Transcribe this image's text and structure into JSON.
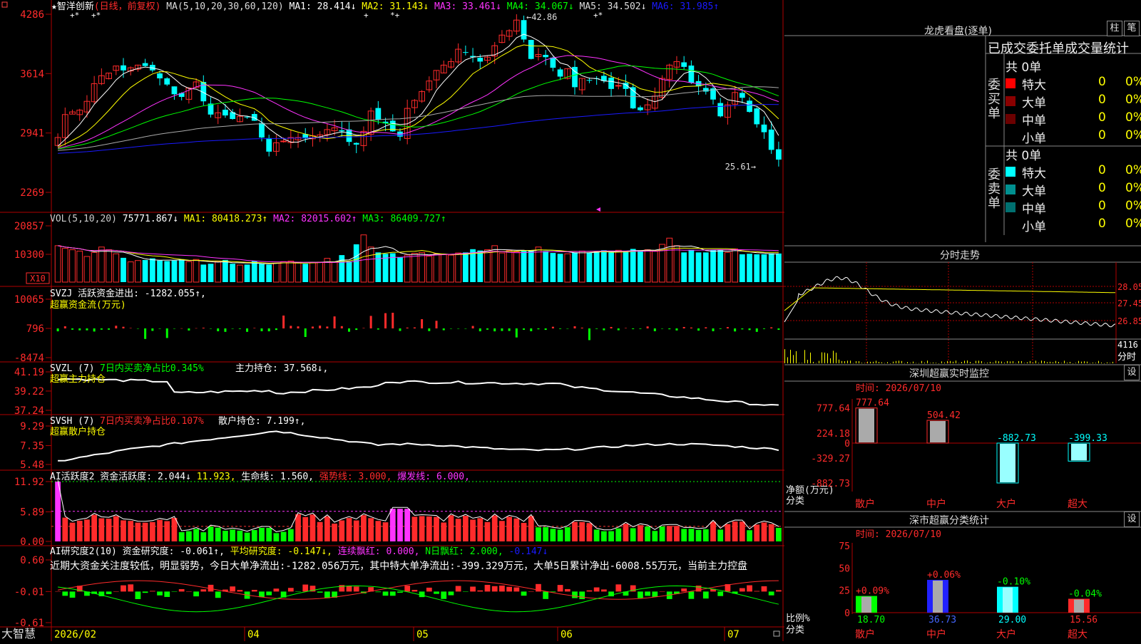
{
  "colors": {
    "up": "#ff2b2b",
    "down": "#00ffff",
    "bg": "#000000",
    "axis": "#b00000",
    "ma1": "#ffffff",
    "ma2": "#ffff00",
    "ma3": "#ff33ff",
    "ma4": "#00ff00",
    "ma5": "#aaaaaa",
    "ma6": "#1a1aff",
    "green": "#00ff00"
  },
  "main_panel": {
    "stock_name": "智洋创新",
    "mode": "(日线，前复权)",
    "ma_params": "MA(5,10,20,30,60,120)",
    "ma1": "MA1: 28.414↓",
    "ma2": "MA2: 31.143↓",
    "ma3": "MA3: 33.461↓",
    "ma4": "MA4: 34.067↓",
    "ma5": "MA5: 34.502↓",
    "ma6": "MA6: 31.985↑",
    "high_label": "42.86",
    "low_label": "25.61",
    "y_ticks": [
      "4286",
      "3614",
      "2941",
      "2269"
    ],
    "markers": [
      "+*",
      "+*",
      "+",
      "*+",
      "+*"
    ]
  },
  "vol_panel": {
    "title": "VOL(5,10,20)",
    "value": "75771.867↓",
    "ma1": "MA1: 80418.273↑",
    "ma2": "MA2: 82015.602↑",
    "ma3": "MA3: 86409.727↑",
    "y_ticks": [
      "20857",
      "10300"
    ],
    "unit": "X10"
  },
  "svzj_panel": {
    "title": "SVZJ  活跃资金进出: -1282.055↑,",
    "subtitle": "超赢资金流(万元)",
    "y_ticks": [
      "10065",
      "796",
      "-8474"
    ]
  },
  "svzl_panel": {
    "title": "SVZL (7)",
    "stat": "7日内买卖净占比0.345%",
    "hold": "主力持仓: 37.568↓,",
    "subtitle": "超赢主力持仓",
    "y_ticks": [
      "41.19",
      "39.22",
      "37.24"
    ]
  },
  "svsh_panel": {
    "title": "SVSH (7)",
    "stat": "7日内买卖净占比0.107%",
    "hold": "散户持仓: 7.199↑,",
    "subtitle": "超赢散户持仓",
    "y_ticks": [
      "9.29",
      "7.35",
      "5.48"
    ]
  },
  "ai1_panel": {
    "title": "AI活跃度2",
    "a": "资金活跃度: 2.044↓",
    "b": "11.923,",
    "c": "生命线: 1.560,",
    "d": "强势线: 3.000,",
    "e": "爆发线: 6.000,",
    "y_ticks": [
      "11.92",
      "5.89",
      "0.00"
    ]
  },
  "ai2_panel": {
    "title": "AI研究度2(10)",
    "a": "资金研究度: -0.061↑,",
    "b": "平均研究度: -0.147↓,",
    "c": "连续飘红: 0.000,",
    "d": "N日飘红: 2.000,",
    "e": "-0.147↓",
    "comment": "近期大资金关注度较低，明显弱势，今日大单净流出:-1282.056万元，其中特大单净流出:-399.329万元，大单5日累计净出-6008.55万元，当前主力控盘",
    "y_ticks": [
      "0.60",
      "-0.01",
      "-0.61"
    ]
  },
  "x_axis": {
    "labels": [
      "2026/02",
      "04",
      "05",
      "06",
      "07"
    ],
    "brand": "大智慧"
  },
  "lhb": {
    "title": "龙虎看盘(逐单)",
    "btn1": "柱",
    "btn2": "笔",
    "header": "已成交委托单成交量统计",
    "buy_label": "委买单",
    "sell_label": "委卖单",
    "total": "共 0单",
    "rows": [
      {
        "name": "特大",
        "v": "0",
        "p": "0%"
      },
      {
        "name": "大单",
        "v": "0",
        "p": "0%"
      },
      {
        "name": "中单",
        "v": "0",
        "p": "0%"
      },
      {
        "name": "小单",
        "v": "0",
        "p": "0%"
      }
    ],
    "buy_colors": [
      "#ff0000",
      "#8b0000",
      "#6b0000"
    ],
    "sell_colors": [
      "#00ffff",
      "#009090",
      "#007070"
    ]
  },
  "fenshi": {
    "title": "分时走势",
    "prices": [
      "28.05",
      "27.45",
      "26.85"
    ],
    "vol": "4116",
    "vol_label": "分时"
  },
  "sz_monitor": {
    "title": "深圳超赢实时监控",
    "btn": "设",
    "time": "时间: 2026/07/10",
    "y_ticks": [
      "777.64",
      "224.18",
      "0",
      "-329.27",
      "-882.73"
    ],
    "ylabel": "净额(万元)",
    "xlabel": "分类",
    "cats": [
      "散户",
      "中户",
      "大户",
      "超大"
    ],
    "values": [
      777.64,
      504.42,
      -882.73,
      -399.33
    ],
    "value_labels": [
      "777.64",
      "504.42",
      "-882.73",
      "-399.33"
    ]
  },
  "sz_class": {
    "title": "深市超赢分类统计",
    "btn": "设",
    "time": "时间: 2026/07/10",
    "y_ticks": [
      "75",
      "50",
      "25",
      "0"
    ],
    "ylabel": "比例%",
    "xlabel": "分类",
    "cats": [
      "散户",
      "中户",
      "大户",
      "超大"
    ],
    "values": [
      18.7,
      36.73,
      29.0,
      15.56
    ],
    "value_labels": [
      "18.70",
      "36.73",
      "29.00",
      "15.56"
    ],
    "changes": [
      "+0.09%",
      "+0.06%",
      "-0.10%",
      "-0.04%"
    ]
  },
  "chart_data": [
    {
      "type": "candlestick",
      "title": "智洋创新(日线，前复权)",
      "ylim": [
        22.69,
        42.86
      ],
      "high": 42.86,
      "low": 25.61,
      "closes": [
        28.9,
        31.5,
        31.8,
        32.0,
        33.0,
        35.0,
        35.9,
        36.2,
        37.0,
        36.5,
        36.8,
        37.1,
        37.0,
        36.5,
        35.6,
        34.9,
        33.8,
        33.5,
        34.5,
        35.2,
        33.0,
        31.5,
        31.7,
        31.4,
        31.0,
        31.3,
        31.2,
        30.8,
        28.9,
        27.3,
        28.3,
        28.5,
        28.9,
        28.9,
        28.8,
        29.1,
        29.2,
        29.8,
        30.0,
        29.6,
        28.4,
        28.1,
        29.6,
        31.9,
        30.9,
        30.5,
        29.6,
        29.0,
        32.2,
        33.1,
        34.1,
        35.3,
        36.5,
        37.1,
        37.5,
        38.9,
        38.5,
        38.0,
        37.5,
        38.0,
        39.3,
        40.5,
        41.0,
        42.2,
        40.0,
        37.8,
        38.3,
        38.0,
        36.8,
        35.8,
        36.7,
        34.6,
        35.6,
        35.4,
        35.6,
        35.3,
        34.4,
        34.8,
        34.4,
        32.2,
        32.0,
        32.6,
        33.6,
        35.6,
        37.1,
        37.5,
        36.9,
        35.1,
        34.7,
        34.1,
        33.2,
        31.3,
        32.6,
        34.0,
        33.4,
        31.8,
        30.4,
        29.5,
        27.5,
        26.4
      ]
    },
    {
      "type": "bar",
      "title": "VOL(5,10,20)",
      "values": [
        13500,
        12500,
        12000,
        11500,
        9500,
        11000,
        13000,
        12000,
        10500,
        9000,
        7500,
        8000,
        8200,
        8800,
        8000,
        7800,
        8000,
        8500,
        7600,
        8400,
        6500,
        6800,
        7700,
        8200,
        6800,
        6300,
        6500,
        7800,
        6800,
        6500,
        7000,
        7600,
        7800,
        7400,
        6800,
        7200,
        7400,
        8800,
        7400,
        10000,
        7700,
        14000,
        17500,
        13000,
        11000,
        10500,
        10700,
        9200,
        10000,
        10700,
        11000,
        9600,
        10500,
        10200,
        10000,
        10800,
        11000,
        12200,
        11700,
        12000,
        13500,
        10800,
        11700,
        11200,
        11800,
        11800,
        13000,
        11500,
        10800,
        10500,
        10500,
        11000,
        11500,
        11000,
        11300,
        11800,
        11000,
        11800,
        11500,
        12300,
        11800,
        12000,
        11400,
        14000,
        16300,
        13500,
        11000,
        12000,
        11000,
        11000,
        12000,
        12000,
        11000,
        12300,
        10300,
        10500,
        10300,
        10300,
        10700,
        10600
      ]
    },
    {
      "type": "bar",
      "title": "超赢资金流(万元)",
      "ylim": [
        -8474,
        10065
      ]
    },
    {
      "type": "line",
      "title": "超赢主力持仓",
      "ylim": [
        37.24,
        41.19
      ]
    },
    {
      "type": "line",
      "title": "超赢散户持仓",
      "ylim": [
        5.48,
        9.29
      ]
    },
    {
      "type": "bar",
      "title": "AI活跃度2",
      "ylim": [
        0,
        11.92
      ]
    },
    {
      "type": "bar",
      "title": "AI研究度2(10)",
      "ylim": [
        -0.61,
        0.6
      ]
    },
    {
      "type": "bar",
      "title": "深圳超赢实时监控",
      "categories": [
        "散户",
        "中户",
        "大户",
        "超大"
      ],
      "values": [
        777.64,
        504.42,
        -882.73,
        -399.33
      ]
    },
    {
      "type": "bar",
      "title": "深市超赢分类统计",
      "categories": [
        "散户",
        "中户",
        "大户",
        "超大"
      ],
      "values": [
        18.7,
        36.73,
        29.0,
        15.56
      ]
    }
  ]
}
